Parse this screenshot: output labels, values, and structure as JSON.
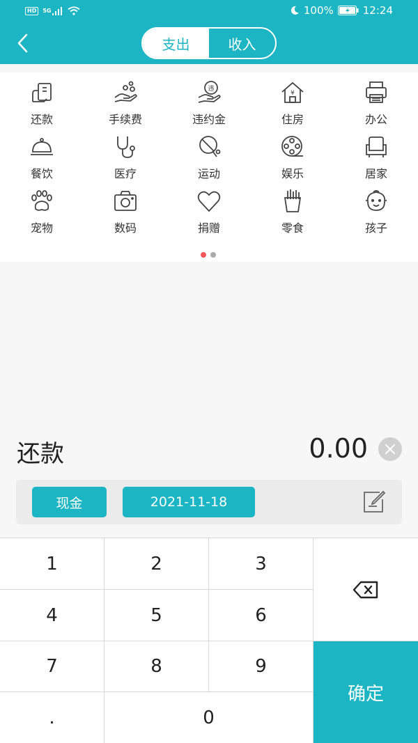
{
  "statusbar": {
    "network": "5G",
    "battery": "100%",
    "time": "12:24"
  },
  "header": {
    "tabs": [
      {
        "label": "支出",
        "active": true
      },
      {
        "label": "收入",
        "active": false
      }
    ],
    "accent_color": "#1cb5c3"
  },
  "categories": [
    {
      "label": "还款",
      "icon": "repayment-icon"
    },
    {
      "label": "手续费",
      "icon": "fee-icon"
    },
    {
      "label": "违约金",
      "icon": "penalty-icon"
    },
    {
      "label": "住房",
      "icon": "housing-icon"
    },
    {
      "label": "办公",
      "icon": "printer-icon"
    },
    {
      "label": "餐饮",
      "icon": "dining-cloche-icon"
    },
    {
      "label": "医疗",
      "icon": "stethoscope-icon"
    },
    {
      "label": "运动",
      "icon": "ping-pong-icon"
    },
    {
      "label": "娱乐",
      "icon": "film-reel-icon"
    },
    {
      "label": "居家",
      "icon": "armchair-icon"
    },
    {
      "label": "宠物",
      "icon": "paw-icon"
    },
    {
      "label": "数码",
      "icon": "camera-icon"
    },
    {
      "label": "捐赠",
      "icon": "heart-icon"
    },
    {
      "label": "零食",
      "icon": "fries-icon"
    },
    {
      "label": "孩子",
      "icon": "baby-icon"
    }
  ],
  "pager": {
    "pages": 2,
    "current": 1
  },
  "entry": {
    "selected_category": "还款",
    "amount": "0.00"
  },
  "tags": {
    "account": "现金",
    "date": "2021-11-18"
  },
  "keypad": {
    "keys": [
      "1",
      "2",
      "3",
      "4",
      "5",
      "6",
      "7",
      "8",
      "9",
      ".",
      "0"
    ],
    "confirm": "确定"
  }
}
